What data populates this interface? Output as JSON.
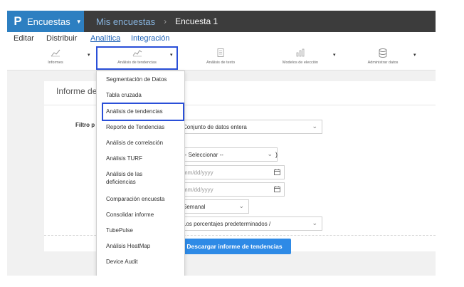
{
  "brand": {
    "logo": "P",
    "name": "Encuestas",
    "caret": "▼"
  },
  "breadcrumb": {
    "first": "Mis encuestas",
    "separator": "›",
    "second": "Encuesta 1"
  },
  "menu": {
    "items": [
      "Editar",
      "Distribuir",
      "Analítica",
      "Integración"
    ]
  },
  "toolbar": {
    "tools": [
      {
        "label": "Informes",
        "icon": "line-chart-icon"
      },
      {
        "label": "Análisis de tendencias",
        "icon": "trend-chart-icon"
      },
      {
        "label": "Análisis de texto",
        "icon": "text-grid-icon"
      },
      {
        "label": "Modelos de elección",
        "icon": "bar-chart-icon"
      },
      {
        "label": "Administrar datos",
        "icon": "database-icon"
      }
    ],
    "caret": "▾"
  },
  "panel": {
    "title": "Informe de",
    "filter_label": "Filtro p",
    "dataset_value": "Conjunto de datos entera",
    "select_value": "-- Seleccionar --",
    "date_placeholder_1": "mm/dd/yyyy",
    "date_placeholder_2": "mm/dd/yyyy",
    "period_value": "Semanal",
    "percent_value": "Los porcentajes predeterminados /",
    "bracket": ")",
    "download_label": "Descargar informe de tendencias"
  },
  "dropdown": {
    "items": [
      "Segmentación de Datos",
      "Tabla cruzada",
      "Análisis de tendencias",
      "Reporte de Tendencias",
      "Análisis de correlación",
      "Análisis TURF",
      "Análisis de las",
      "deficiencias",
      "Comparación encuesta",
      "Consolidar informe",
      "TubePulse",
      "Análisis HeatMap",
      "Device Audit"
    ]
  },
  "colors": {
    "brand_blue": "#2d7fc1",
    "topbar": "#3c3c3c",
    "highlight": "#2a4fd8",
    "button_blue": "#2e8ae6"
  }
}
